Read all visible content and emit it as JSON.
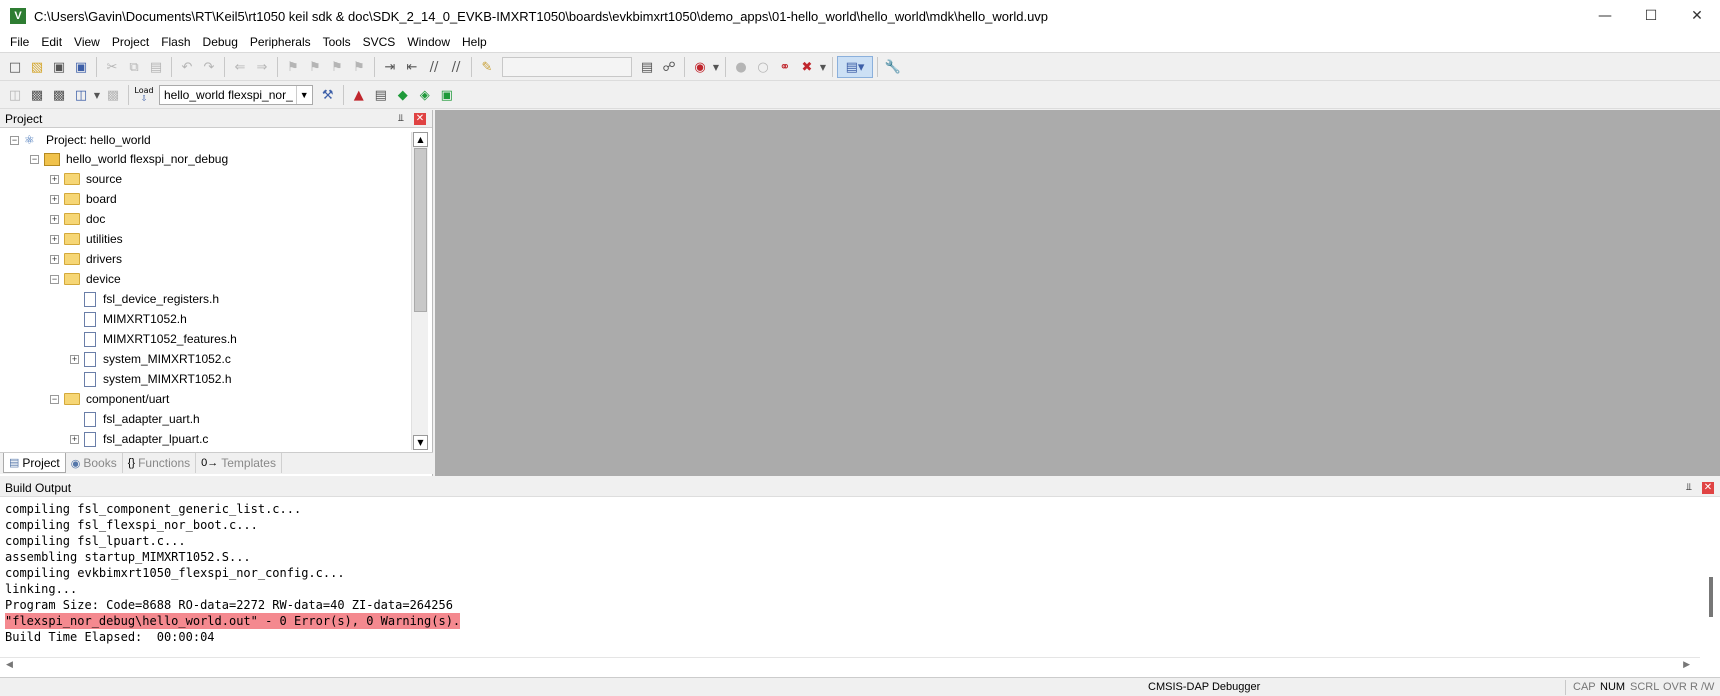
{
  "window": {
    "title": "C:\\Users\\Gavin\\Documents\\RT\\Keil5\\rt1050 keil sdk & doc\\SDK_2_14_0_EVKB-IMXRT1050\\boards\\evkbimxrt1050\\demo_apps\\01-hello_world\\hello_world\\mdk\\hello_world.uvp",
    "app_icon_letter": "V",
    "minimize": "—",
    "maximize": "☐",
    "close": "✕"
  },
  "menu": [
    "File",
    "Edit",
    "View",
    "Project",
    "Flash",
    "Debug",
    "Peripherals",
    "Tools",
    "SVCS",
    "Window",
    "Help"
  ],
  "toolbar2": {
    "target_select": "hello_world flexspi_nor_",
    "load_label": "Load"
  },
  "project_panel": {
    "title": "Project",
    "pin": "⫫",
    "close": "✕",
    "tree": [
      {
        "label": "Project: hello_world",
        "type": "project",
        "exp": "−"
      },
      {
        "label": "hello_world flexspi_nor_debug",
        "type": "target",
        "exp": "−"
      },
      {
        "label": "source",
        "type": "folder",
        "exp": "+"
      },
      {
        "label": "board",
        "type": "folder",
        "exp": "+"
      },
      {
        "label": "doc",
        "type": "folder",
        "exp": "+"
      },
      {
        "label": "utilities",
        "type": "folder",
        "exp": "+"
      },
      {
        "label": "drivers",
        "type": "folder",
        "exp": "+"
      },
      {
        "label": "device",
        "type": "folder",
        "exp": "−"
      },
      {
        "label": "fsl_device_registers.h",
        "type": "file",
        "exp": ""
      },
      {
        "label": "MIMXRT1052.h",
        "type": "file",
        "exp": ""
      },
      {
        "label": "MIMXRT1052_features.h",
        "type": "file",
        "exp": ""
      },
      {
        "label": "system_MIMXRT1052.c",
        "type": "file",
        "exp": "+"
      },
      {
        "label": "system_MIMXRT1052.h",
        "type": "file",
        "exp": ""
      },
      {
        "label": "component/uart",
        "type": "folder",
        "exp": "−"
      },
      {
        "label": "fsl_adapter_uart.h",
        "type": "file",
        "exp": ""
      },
      {
        "label": "fsl_adapter_lpuart.c",
        "type": "file",
        "exp": "+"
      }
    ],
    "tabs": [
      {
        "label": "Project",
        "icon": "▤"
      },
      {
        "label": "Books",
        "icon": "◉"
      },
      {
        "label": "Functions",
        "icon": "{}"
      },
      {
        "label": "Templates",
        "icon": "0→"
      }
    ]
  },
  "build_output": {
    "title": "Build Output",
    "lines": [
      "compiling fsl_component_generic_list.c...",
      "compiling fsl_flexspi_nor_boot.c...",
      "compiling fsl_lpuart.c...",
      "assembling startup_MIMXRT1052.S...",
      "compiling evkbimxrt1050_flexspi_nor_config.c...",
      "linking...",
      "Program Size: Code=8688 RO-data=2272 RW-data=40 ZI-data=264256",
      "\"flexspi_nor_debug\\hello_world.out\" - 0 Error(s), 0 Warning(s).",
      "Build Time Elapsed:  00:00:04"
    ],
    "highlight_line": 7,
    "highlight_color": "#f4898f",
    "scroll_left": "◀",
    "scroll_right": "▶"
  },
  "status": {
    "debugger": "CMSIS-DAP Debugger",
    "cap": "CAP",
    "num": "NUM",
    "scrl": "SCRL",
    "ovr": "OVR",
    "rw": "R /W"
  }
}
